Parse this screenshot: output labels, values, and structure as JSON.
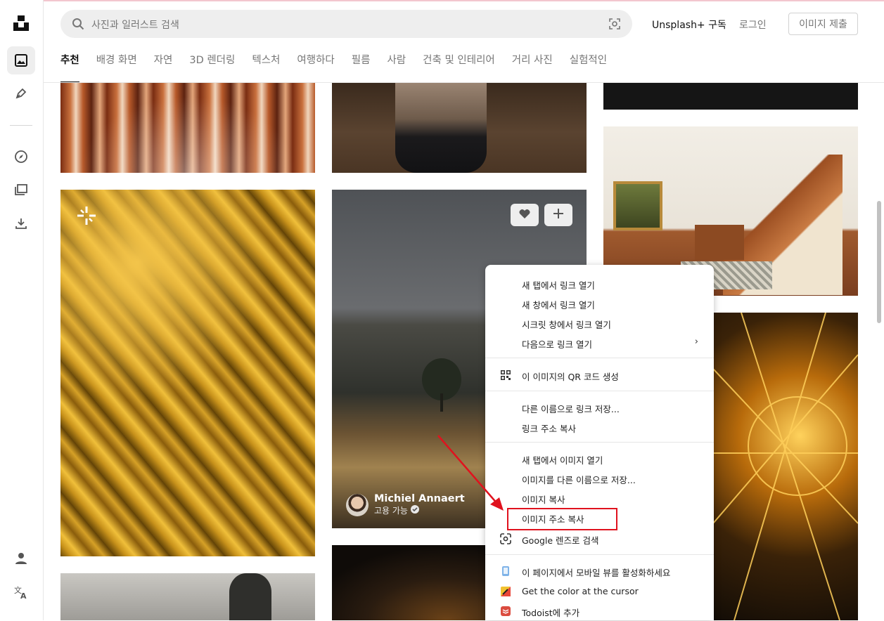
{
  "search": {
    "placeholder": "사진과 일러스트 검색"
  },
  "header": {
    "subscribe": "Unsplash+ 구독",
    "login": "로그인",
    "submit": "이미지 제출"
  },
  "tabs": [
    {
      "label": "추천",
      "active": true
    },
    {
      "label": "배경 화면"
    },
    {
      "label": "자연"
    },
    {
      "label": "3D 렌더링"
    },
    {
      "label": "텍스처"
    },
    {
      "label": "여행하다"
    },
    {
      "label": "필름"
    },
    {
      "label": "사람"
    },
    {
      "label": "건축 및 인테리어"
    },
    {
      "label": "거리 사진"
    },
    {
      "label": "실험적인"
    }
  ],
  "photo": {
    "author": "Michiel Annaert",
    "hire": "고용 가능"
  },
  "context_menu": {
    "items": [
      {
        "label": "새 탭에서 링크 열기"
      },
      {
        "label": "새 창에서 링크 열기"
      },
      {
        "label": "시크릿 창에서 링크 열기"
      },
      {
        "label": "다음으로 링크 열기",
        "submenu": true
      },
      {
        "label": "이 이미지의 QR 코드 생성",
        "icon": "qr-code-icon"
      },
      {
        "label": "다른 이름으로 링크 저장..."
      },
      {
        "label": "링크 주소 복사"
      },
      {
        "label": "새 탭에서 이미지 열기"
      },
      {
        "label": "이미지를 다른 이름으로 저장..."
      },
      {
        "label": "이미지 복사"
      },
      {
        "label": "이미지 주소 복사",
        "highlighted": true
      },
      {
        "label": "Google 렌즈로 검색",
        "icon": "google-lens-icon"
      },
      {
        "label": "이 페이지에서 모바일 뷰를 활성화하세요",
        "icon": "mobile-view-icon"
      },
      {
        "label": "Get the color at the cursor",
        "icon": "color-picker-icon"
      },
      {
        "label": "Todoist에 추가",
        "icon": "todoist-icon"
      }
    ]
  },
  "colors": {
    "annotation": "#e0121e",
    "accent": "#111111"
  }
}
